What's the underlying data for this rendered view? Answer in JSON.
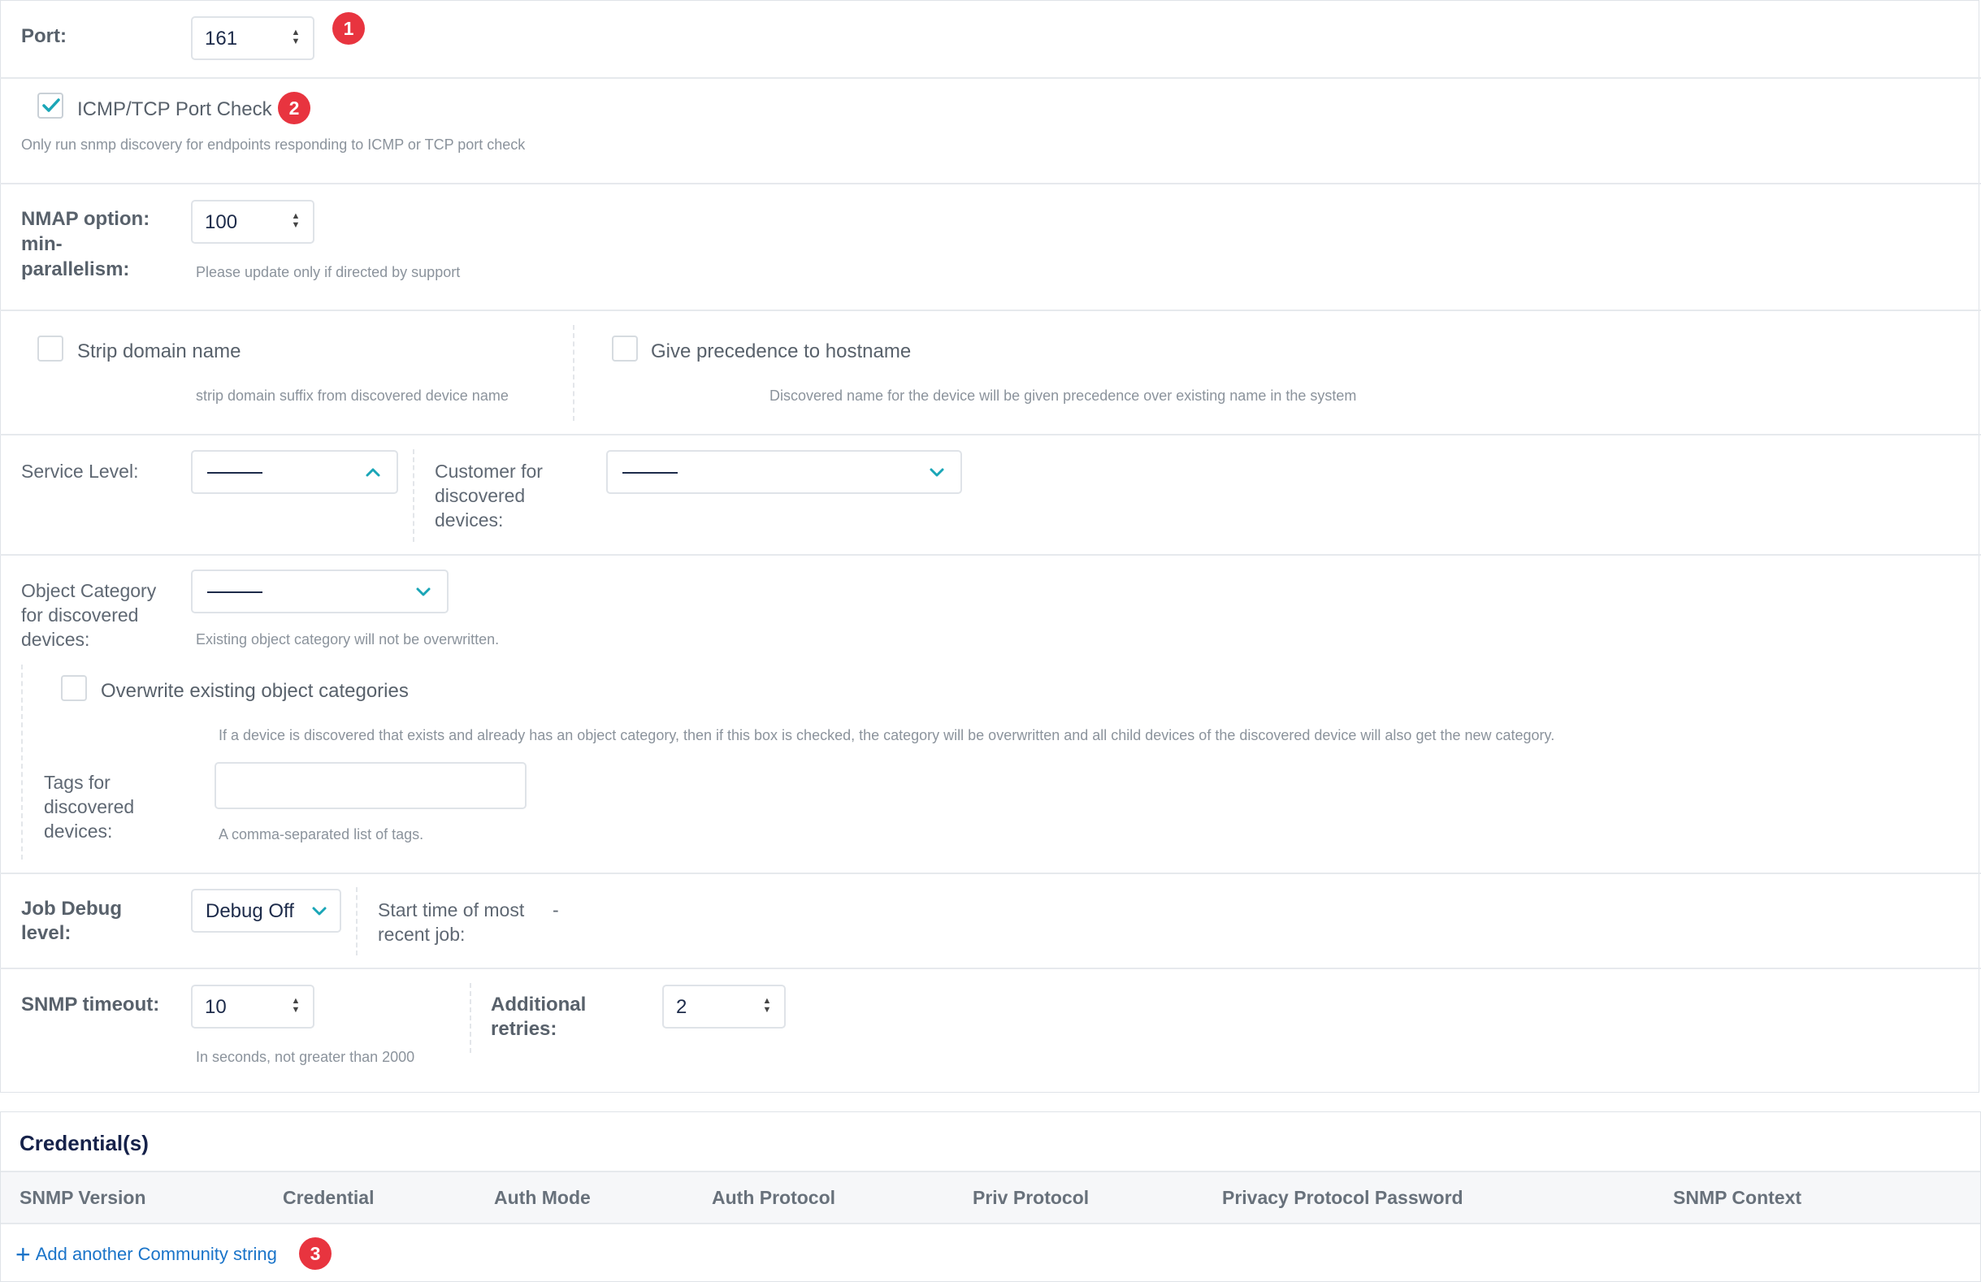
{
  "port": {
    "label": "Port:",
    "value": "161"
  },
  "icmp_check": {
    "label": "ICMP/TCP Port Check",
    "checked": true,
    "help": "Only run snmp discovery for endpoints responding to ICMP or TCP port check"
  },
  "nmap": {
    "label_line1": "NMAP option:",
    "label_line2": "min-",
    "label_line3": "parallelism:",
    "value": "100",
    "help": "Please update only if directed by support"
  },
  "strip_domain": {
    "label": "Strip domain name",
    "checked": false,
    "help": "strip domain suffix from discovered device name"
  },
  "hostname_precedence": {
    "label": "Give precedence to hostname",
    "checked": false,
    "help": "Discovered name for the device will be given precedence over existing name in the system"
  },
  "service_level": {
    "label": "Service Level:",
    "value": ""
  },
  "customer": {
    "label_line1": "Customer for",
    "label_line2": "discovered",
    "label_line3": "devices:",
    "value": ""
  },
  "object_category": {
    "label_line1": "Object Category",
    "label_line2": "for discovered",
    "label_line3": "devices:",
    "value": "",
    "help": "Existing object category will not be overwritten."
  },
  "overwrite_categories": {
    "label": "Overwrite existing object categories",
    "checked": false,
    "help": "If a device is discovered that exists and already has an object category, then if this box is checked, the category will be overwritten and all child devices of the discovered device will also get the new category."
  },
  "tags": {
    "label_line1": "Tags for",
    "label_line2": "discovered",
    "label_line3": "devices:",
    "value": "",
    "help": "A comma-separated list of tags."
  },
  "job_debug": {
    "label_line1": "Job Debug",
    "label_line2": "level:",
    "value": "Debug Off"
  },
  "start_time": {
    "label_line1": "Start time of most",
    "label_line2": "recent job:",
    "value": "-"
  },
  "snmp_timeout": {
    "label": "SNMP timeout:",
    "value": "10",
    "help": "In seconds, not greater than 2000"
  },
  "retries": {
    "label_line1": "Additional",
    "label_line2": "retries:",
    "value": "2"
  },
  "credentials": {
    "title": "Credential(s)",
    "columns": [
      "SNMP Version",
      "Credential",
      "Auth Mode",
      "Auth Protocol",
      "Priv Protocol",
      "Privacy Protocol Password",
      "SNMP Context"
    ],
    "add_label": "Add another Community string"
  },
  "badges": [
    "1",
    "2",
    "3"
  ],
  "colors": {
    "accent": "#1aa6b7",
    "badge": "#e8343f",
    "link": "#1a74c9",
    "title": "#16224a"
  }
}
